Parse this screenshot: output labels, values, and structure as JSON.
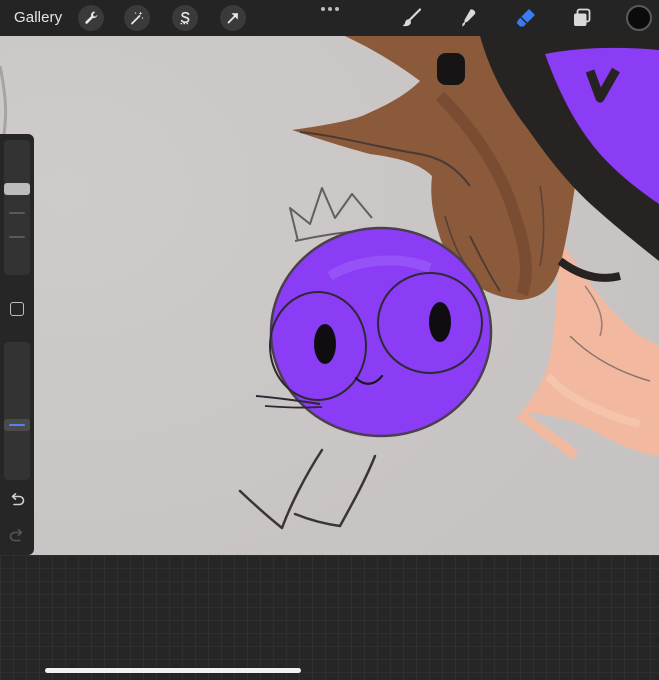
{
  "app": {
    "gallery_label": "Gallery"
  },
  "toolbar": {
    "left_icons": [
      "wrench-icon",
      "magic-wand-icon",
      "selection-s-icon",
      "transform-arrow-icon"
    ],
    "right_tools": [
      "brush-icon",
      "smudge-icon",
      "eraser-icon",
      "layers-icon"
    ],
    "active_tool": "eraser",
    "accent_color": "#3b7bf6",
    "current_color": "#0b0b0b"
  },
  "sidebar": {
    "brush_size_level": 0.65,
    "opacity_level": 0.39,
    "size_thumb_color": "#bdbdbd",
    "opacity_thumb_color": "#4f83f0"
  },
  "canvas": {
    "background_color": "#cdc9c9",
    "purple_color": "#8b3df5",
    "hair_color": "#8a5a3b",
    "skin_color": "#f2b9a0"
  }
}
